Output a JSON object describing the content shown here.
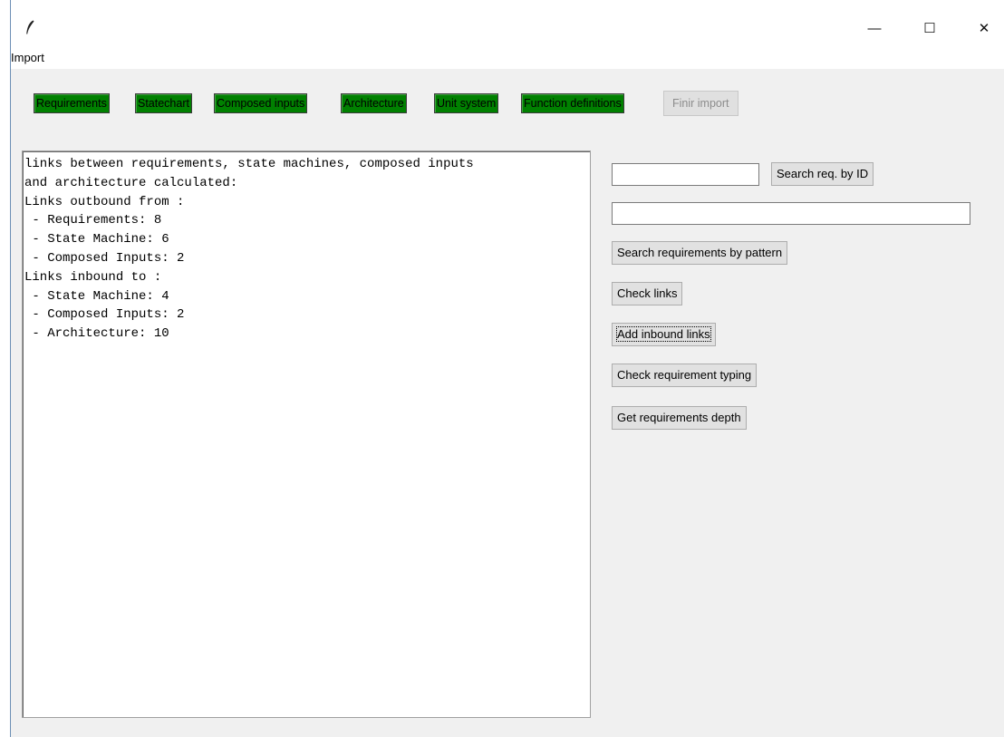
{
  "window": {
    "icon": "feather-icon",
    "controls": {
      "minimize": "—",
      "maximize": "☐",
      "close": "✕"
    }
  },
  "menu": {
    "import_label": "Import"
  },
  "tabs": [
    {
      "label": "Requirements",
      "state": "done"
    },
    {
      "label": "Statechart",
      "state": "done"
    },
    {
      "label": "Composed inputs",
      "state": "done"
    },
    {
      "label": "Architecture",
      "state": "done"
    },
    {
      "label": "Unit system",
      "state": "done"
    },
    {
      "label": "Function definitions",
      "state": "done"
    },
    {
      "label": "Finir import",
      "state": "disabled"
    }
  ],
  "output": {
    "text": "links between requirements, state machines, composed inputs\nand architecture calculated:\nLinks outbound from :\n - Requirements: 8\n - State Machine: 6\n - Composed Inputs: 2\nLinks inbound to :\n - State Machine: 4\n - Composed Inputs: 2\n - Architecture: 10"
  },
  "search": {
    "id_value": "",
    "id_button": "Search req. by ID",
    "pattern_value": "",
    "pattern_button": "Search requirements by pattern"
  },
  "actions": {
    "check_links": "Check links",
    "add_inbound_links": "Add inbound links",
    "check_typing": "Check requirement typing",
    "get_depth": "Get requirements depth"
  },
  "colors": {
    "done_tab": "#008000",
    "disabled_tab": "#e0e0e0",
    "window_bg": "#f0f0f0"
  }
}
